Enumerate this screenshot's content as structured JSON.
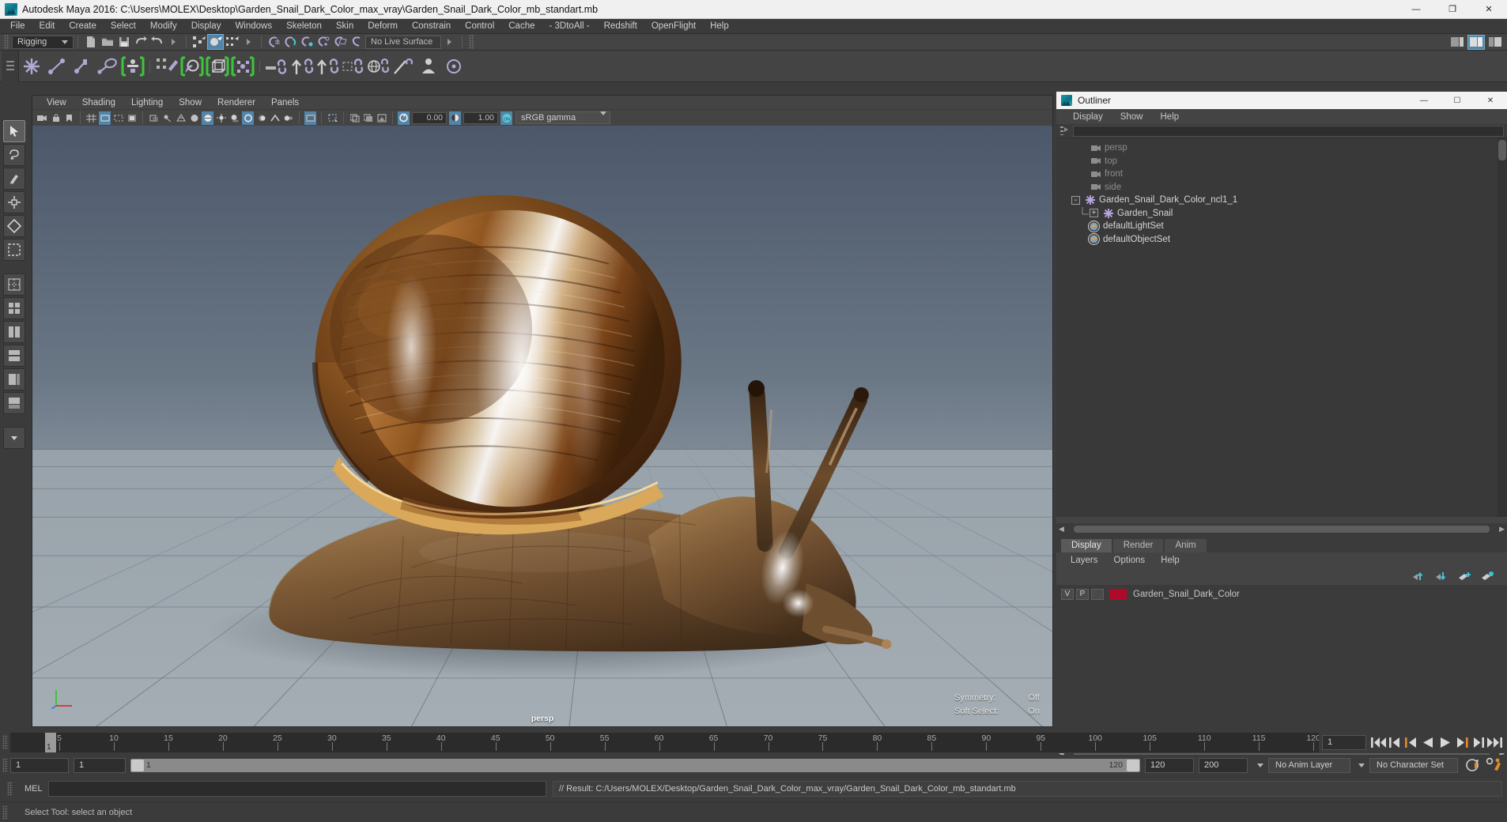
{
  "window": {
    "title": "Autodesk Maya 2016: C:\\Users\\MOLEX\\Desktop\\Garden_Snail_Dark_Color_max_vray\\Garden_Snail_Dark_Color_mb_standart.mb",
    "app_icon": "maya-icon",
    "minimize": "—",
    "maximize": "❐",
    "close": "✕"
  },
  "menubar": {
    "items": [
      "File",
      "Edit",
      "Create",
      "Select",
      "Modify",
      "Display",
      "Windows",
      "Skeleton",
      "Skin",
      "Deform",
      "Constrain",
      "Control",
      "Cache",
      "- 3DtoAll -",
      "Redshift",
      "OpenFlight",
      "Help"
    ]
  },
  "statusline": {
    "menuset": "Rigging",
    "live_surface": "No Live Surface",
    "icons": [
      "new-scene-icon",
      "open-scene-icon",
      "save-scene-icon",
      "undo-icon",
      "redo-icon",
      "select-by-hierarchy-icon",
      "select-by-object-icon",
      "select-by-component-icon",
      "snap-to-grid-icon",
      "snap-to-curve-icon",
      "snap-to-point-icon",
      "snap-to-projected-center-icon",
      "snap-to-view-plane-icon",
      "make-live-icon",
      "show-manipulator-icon",
      "render-view-icon",
      "render-icon",
      "ipr-render-icon",
      "render-settings-icon"
    ],
    "right_icons": [
      "sidebar-attribute-editor-icon",
      "sidebar-tool-settings-icon",
      "sidebar-channel-box-icon"
    ]
  },
  "shelf": {
    "icons": [
      "joint-tool-icon",
      "ik-handle-tool-icon",
      "ik-spline-handle-icon",
      "ik-rp-solver-icon",
      "create-skeleton-icon",
      "paint-skin-weights-icon",
      "bind-skin-icon",
      "lattice-deformer-icon",
      "cluster-deformer-icon",
      "wrap-deformer-icon",
      "parent-constraint-icon",
      "point-constraint-icon",
      "orient-constraint-icon",
      "scale-constraint-icon",
      "aim-constraint-icon",
      "pole-vector-constraint-icon",
      "character-set-icon",
      "quick-rig-icon"
    ]
  },
  "toolbox": {
    "items": [
      "select-tool",
      "lasso-select-tool",
      "paint-select-tool",
      "move-tool",
      "rotate-tool",
      "scale-tool",
      "last-tool",
      "snap-mode",
      "layout-single-pane",
      "layout-two-pane-side",
      "layout-two-pane-stacked",
      "layout-four-pane",
      "layout-persp-outliner",
      "layout-persp-graph",
      "layout-more"
    ]
  },
  "viewport": {
    "menus": [
      "View",
      "Shading",
      "Lighting",
      "Show",
      "Renderer",
      "Panels"
    ],
    "exposure_value": "0.00",
    "gamma_value": "1.00",
    "color_management": "sRGB gamma",
    "camera_label": "persp",
    "hud": [
      {
        "label": "Symmetry:",
        "value": "Off"
      },
      {
        "label": "Soft Select:",
        "value": "On"
      }
    ],
    "toolbar_icons": [
      "select-camera-icon",
      "lock-camera-icon",
      "bookmark-icon",
      "grid-toggle-icon",
      "film-gate-icon",
      "resolution-gate-icon",
      "gate-mask-icon",
      "xray-toggle-icon",
      "xray-joints-icon",
      "wireframe-icon",
      "smooth-shade-icon",
      "smooth-shade-textured-icon",
      "use-all-lights-icon",
      "shadows-icon",
      "screen-space-ao-icon",
      "motion-blur-icon",
      "multisample-aa-icon",
      "depth-of-field-icon",
      "isolate-select-icon",
      "image-plane-icon",
      "two-sided-lighting-icon",
      "exposure-icon",
      "gamma-icon",
      "color-management-icon"
    ]
  },
  "outliner": {
    "title": "Outliner",
    "title_icon": "maya-icon",
    "minimize": "—",
    "maximize": "☐",
    "close": "✕",
    "menus": [
      "Display",
      "Show",
      "Help"
    ],
    "search_icon": "outliner-filter-icon",
    "items": [
      {
        "label": "persp",
        "icon": "camera-icon",
        "indent": 3,
        "dim": true,
        "expander": ""
      },
      {
        "label": "top",
        "icon": "camera-icon",
        "indent": 3,
        "dim": true,
        "expander": ""
      },
      {
        "label": "front",
        "icon": "camera-icon",
        "indent": 3,
        "dim": true,
        "expander": ""
      },
      {
        "label": "side",
        "icon": "camera-icon",
        "indent": 3,
        "dim": true,
        "expander": ""
      },
      {
        "label": "Garden_Snail_Dark_Color_ncl1_1",
        "icon": "transform-icon",
        "indent": 2,
        "dim": false,
        "expander": "-"
      },
      {
        "label": "Garden_Snail",
        "icon": "transform-icon",
        "indent": 4,
        "dim": false,
        "expander": "+"
      },
      {
        "label": "defaultLightSet",
        "icon": "set-icon",
        "indent": 3,
        "dim": false,
        "expander": ""
      },
      {
        "label": "defaultObjectSet",
        "icon": "set-icon",
        "indent": 3,
        "dim": false,
        "expander": ""
      }
    ]
  },
  "layer_editor": {
    "tabs": [
      {
        "label": "Display",
        "active": true
      },
      {
        "label": "Render",
        "active": false
      },
      {
        "label": "Anim",
        "active": false
      }
    ],
    "menus": [
      "Layers",
      "Options",
      "Help"
    ],
    "buttons": [
      "move-layer-up-icon",
      "move-layer-down-icon",
      "new-layer-icon",
      "new-layer-from-selected-icon"
    ],
    "layers": [
      {
        "visibility": "V",
        "playback": "P",
        "type": "",
        "color": "#b00a2a",
        "name": "Garden_Snail_Dark_Color"
      }
    ]
  },
  "timeline": {
    "start": 1,
    "end": 120,
    "current_frame": "1",
    "ticks": [
      5,
      10,
      15,
      20,
      25,
      30,
      35,
      40,
      45,
      50,
      55,
      60,
      65,
      70,
      75,
      80,
      85,
      90,
      95,
      100,
      105,
      110,
      115,
      120
    ],
    "playback_icons": [
      "go-to-start-icon",
      "step-back-frame-icon",
      "step-back-key-icon",
      "play-backwards-icon",
      "play-forwards-icon",
      "step-forward-key-icon",
      "step-forward-frame-icon",
      "go-to-end-icon"
    ]
  },
  "rangeslider": {
    "anim_start": "1",
    "range_start": "1",
    "bar_left_label": "1",
    "bar_right_label": "120",
    "range_end": "120",
    "anim_end": "200",
    "anim_layer": "No Anim Layer",
    "character_set": "No Character Set",
    "auto_key_icon": "auto-keyframe-icon",
    "anim_prefs_icon": "animation-preferences-icon"
  },
  "command_line": {
    "label": "MEL",
    "input_value": "",
    "result": "// Result: C:/Users/MOLEX/Desktop/Garden_Snail_Dark_Color_max_vray/Garden_Snail_Dark_Color_mb_standart.mb"
  },
  "help_line": {
    "text": "Select Tool: select an object"
  },
  "colors": {
    "accent_blue": "#5285a8",
    "highlight_green": "#3ec53e",
    "layer_swatch": "#b00a2a",
    "panel_bg": "#444444",
    "dark_bg": "#3b3b3b"
  }
}
